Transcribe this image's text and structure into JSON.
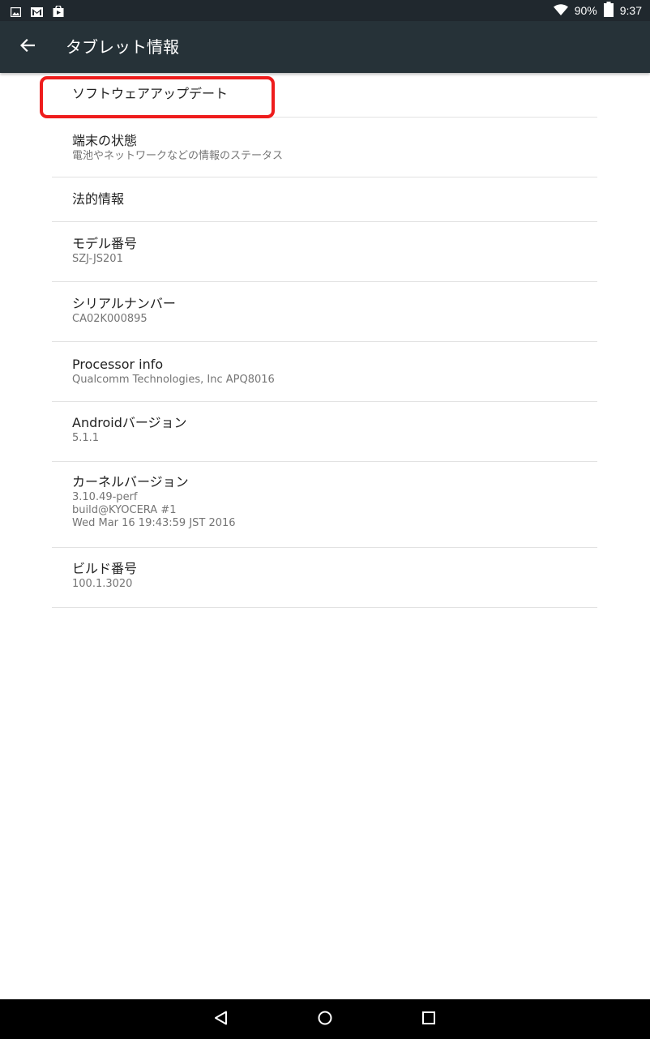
{
  "status_bar": {
    "icons_left": [
      "image-icon",
      "gmail-icon",
      "store-bag-icon"
    ],
    "battery_percent": "90%",
    "time": "9:37"
  },
  "toolbar": {
    "title": "タブレット情報"
  },
  "list": {
    "items": [
      {
        "title": "ソフトウェアアップデート",
        "lines": []
      },
      {
        "title": "端末の状態",
        "lines": [
          "電池やネットワークなどの情報のステータス"
        ]
      },
      {
        "title": "法的情報",
        "lines": []
      },
      {
        "title": "モデル番号",
        "lines": [
          "SZJ-JS201"
        ]
      },
      {
        "title": "シリアルナンバー",
        "lines": [
          "CA02K000895"
        ]
      },
      {
        "title": "Processor info",
        "lines": [
          "Qualcomm Technologies, Inc APQ8016"
        ]
      },
      {
        "title": "Androidバージョン",
        "lines": [
          "5.1.1"
        ]
      },
      {
        "title": "カーネルバージョン",
        "lines": [
          "3.10.49-perf",
          "build@KYOCERA #1",
          "Wed Mar 16 19:43:59 JST 2016"
        ]
      },
      {
        "title": "ビルド番号",
        "lines": [
          "100.1.3020"
        ]
      }
    ]
  },
  "colors": {
    "status_bar": "#20282e",
    "toolbar": "#263238",
    "highlight": "#ee1c1c",
    "divider": "#e2e2e2"
  }
}
